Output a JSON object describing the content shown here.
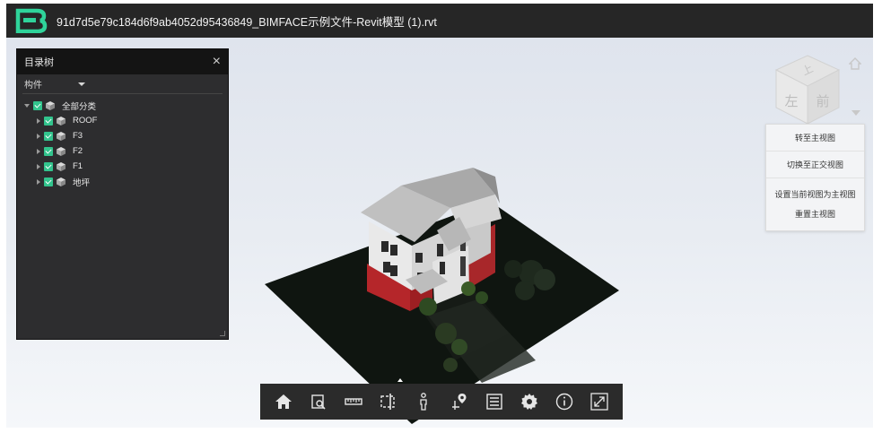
{
  "window": {
    "title": "91d7d5e79c184d6f9ab4052d95436849_BIMFACE示例文件-Revit模型 (1).rvt"
  },
  "tree_panel": {
    "title": "目录树",
    "close_glyph": "×",
    "filter": "构件",
    "nodes": [
      {
        "label": "全部分类",
        "level": 0,
        "checked": true,
        "expanded": true
      },
      {
        "label": "ROOF",
        "level": 1,
        "checked": true,
        "expanded": false
      },
      {
        "label": "F3",
        "level": 1,
        "checked": true,
        "expanded": false
      },
      {
        "label": "F2",
        "level": 1,
        "checked": true,
        "expanded": false
      },
      {
        "label": "F1",
        "level": 1,
        "checked": true,
        "expanded": false
      },
      {
        "label": "地坪",
        "level": 1,
        "checked": true,
        "expanded": false
      }
    ]
  },
  "viewcube": {
    "face_left": "左",
    "face_front": "前"
  },
  "context_menu": {
    "items": [
      "转至主视图",
      "切换至正交视图",
      "设置当前视图为主视图",
      "重置主视图"
    ]
  },
  "toolbar": {
    "buttons": [
      {
        "name": "home-icon"
      },
      {
        "name": "zoom-area-icon"
      },
      {
        "name": "measure-icon"
      },
      {
        "name": "section-box-icon"
      },
      {
        "name": "walk-person-icon"
      },
      {
        "name": "map-pin-icon"
      },
      {
        "name": "properties-icon"
      },
      {
        "name": "settings-icon"
      },
      {
        "name": "info-icon"
      },
      {
        "name": "fullscreen-icon"
      }
    ]
  },
  "colors": {
    "titlebar": "#262626",
    "logo": "#2fd39a",
    "check": "#32c48d",
    "panel": "#2d2d2f",
    "toolbar": "#2b2b2b",
    "wall_red": "#b5262a",
    "ground": "#0f1510"
  }
}
